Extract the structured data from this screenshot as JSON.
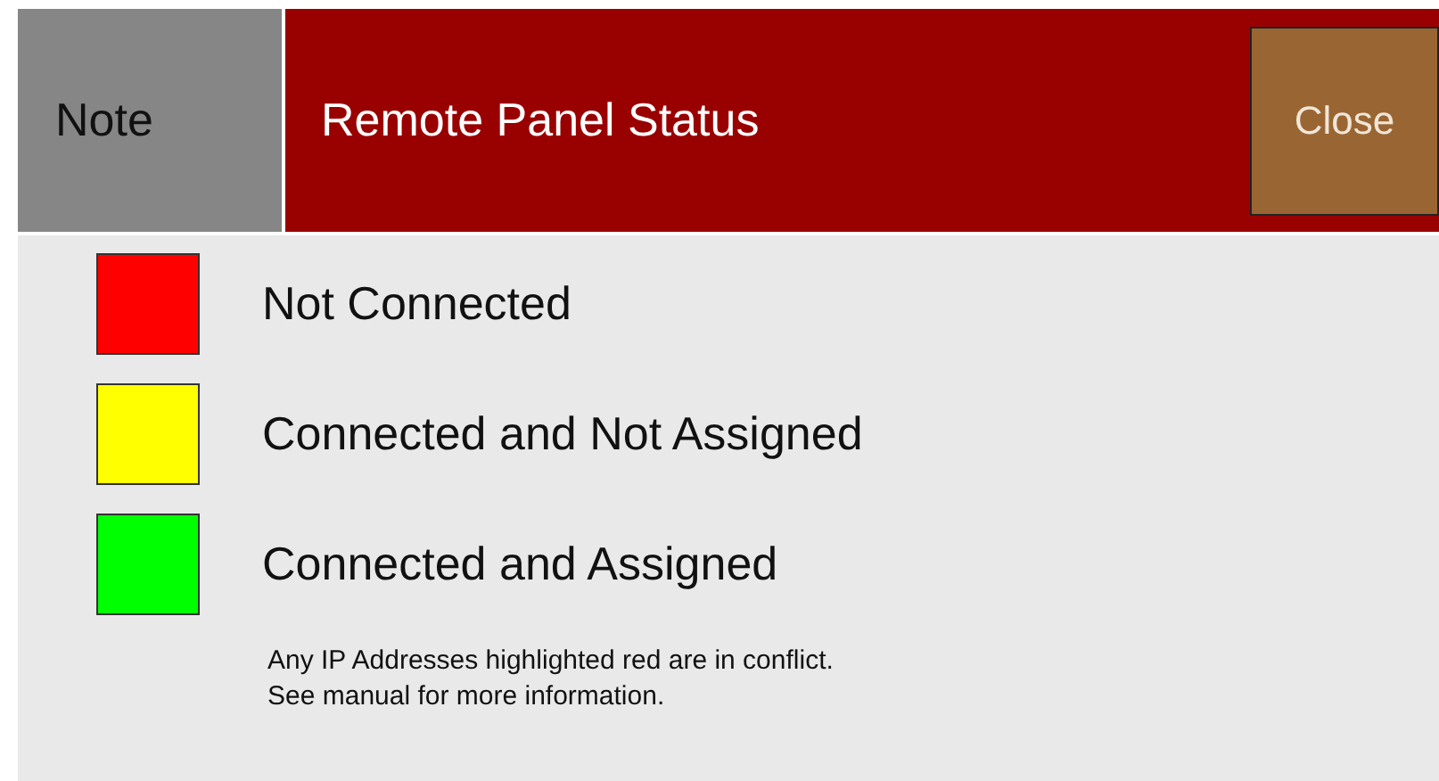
{
  "header": {
    "note_label": "Note",
    "title": "Remote Panel Status",
    "close_button": "Close"
  },
  "legend": [
    {
      "label": "Not Connected",
      "color": "#ff0000"
    },
    {
      "label": "Connected and Not Assigned",
      "color": "#ffff00"
    },
    {
      "label": "Connected and Assigned",
      "color": "#00ff00"
    }
  ],
  "footnote": [
    "Any IP Addresses highlighted red are in conflict.",
    "See manual for more information."
  ]
}
